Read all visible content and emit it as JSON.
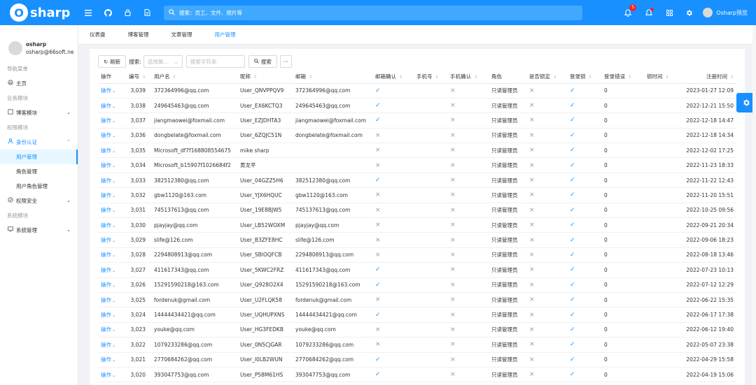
{
  "app": {
    "logo_letter": "O",
    "logo_text": "sharp"
  },
  "topbar": {
    "search_placeholder": "搜索：员工、文件、照片等",
    "notification_count": "5",
    "user_name": "Osharp预览"
  },
  "sidebar": {
    "user_name": "osharp",
    "user_email": "osharp@66soft.ne",
    "groups": {
      "nav": "导航菜单",
      "business": "业务模块",
      "permission": "权限模块",
      "system": "系统模块"
    },
    "items": {
      "home": "主页",
      "blog": "博客模块",
      "identity": "身份认证",
      "user_mgmt": "用户管理",
      "role_mgmt": "角色管理",
      "user_role_mgmt": "用户角色管理",
      "security": "权限安全",
      "sys_mgmt": "系统管理"
    }
  },
  "tabs": [
    "仪表盘",
    "博客管理",
    "文章管理",
    "用户管理"
  ],
  "toolbar": {
    "refresh": "刷新",
    "search_label": "搜索:",
    "select_placeholder": "选择属...",
    "text_placeholder": "搜索字符串",
    "search_btn": "搜索",
    "more": "···"
  },
  "table": {
    "headers": [
      "操作",
      "编号",
      "用户名",
      "昵称",
      "邮箱",
      "邮箱确认",
      "手机号",
      "手机确认",
      "角色",
      "是否锁定",
      "登录锁",
      "登录错误",
      "锁时间",
      "注册时间"
    ],
    "op_label": "操作",
    "rows": [
      {
        "id": "3,039",
        "user": "372364996@qq.com",
        "nick": "User_QNVPPQV9",
        "email": "372364996@qq.com",
        "ec": true,
        "mc": false,
        "role": "只读管理员",
        "locked": false,
        "lock": true,
        "err": "0",
        "time": "2023-01-27 12:09"
      },
      {
        "id": "3,038",
        "user": "249645463@qq.com",
        "nick": "User_EX6KCTQ3",
        "email": "249645463@qq.com",
        "ec": true,
        "mc": false,
        "role": "只读管理员",
        "locked": false,
        "lock": true,
        "err": "0",
        "time": "2022-12-21 15:50"
      },
      {
        "id": "3,037",
        "user": "jiangmaowei@foxmail.com",
        "nick": "User_EZJDHTA3",
        "email": "jiangmaowei@foxmail.com",
        "ec": true,
        "mc": false,
        "role": "只读管理员",
        "locked": false,
        "lock": true,
        "err": "0",
        "time": "2022-12-18 14:47"
      },
      {
        "id": "3,036",
        "user": "dongbelate@foxmail.com",
        "nick": "User_6ZQJC51N",
        "email": "dongbelate@foxmail.com",
        "ec": false,
        "mc": false,
        "role": "只读管理员",
        "locked": false,
        "lock": true,
        "err": "0",
        "time": "2022-12-18 14:34"
      },
      {
        "id": "3,035",
        "user": "Microsoft_df7f16880855467​5",
        "nick": "mike sharp",
        "email": "",
        "ec": false,
        "mc": false,
        "role": "只读管理员",
        "locked": false,
        "lock": true,
        "err": "0",
        "time": "2022-12-02 17:25"
      },
      {
        "id": "3,034",
        "user": "Microsoft_b15907f1026684f2",
        "nick": "黄龙平",
        "email": "",
        "ec": false,
        "mc": false,
        "role": "只读管理员",
        "locked": false,
        "lock": true,
        "err": "0",
        "time": "2022-11-23 18:33"
      },
      {
        "id": "3,033",
        "user": "382512380@qq.com",
        "nick": "User_04GZZ5H6",
        "email": "382512380@qq.com",
        "ec": true,
        "mc": false,
        "role": "只读管理员",
        "locked": false,
        "lock": true,
        "err": "0",
        "time": "2022-11-22 12:43"
      },
      {
        "id": "3,032",
        "user": "gbw1120@163.com",
        "nick": "User_YJX6HQUC",
        "email": "gbw1120@163.com",
        "ec": false,
        "mc": false,
        "role": "只读管理员",
        "locked": false,
        "lock": true,
        "err": "0",
        "time": "2022-11-20 15:51"
      },
      {
        "id": "3,031",
        "user": "745137613@qq.com",
        "nick": "User_19E8BJW5",
        "email": "745137613@qq.com",
        "ec": false,
        "mc": false,
        "role": "只读管理员",
        "locked": false,
        "lock": true,
        "err": "0",
        "time": "2022-10-25 09:56"
      },
      {
        "id": "3,030",
        "user": "pjayjay@qq.com",
        "nick": "User_LB52WOXM",
        "email": "pjayjay@qq.com",
        "ec": false,
        "mc": false,
        "role": "只读管理员",
        "locked": false,
        "lock": true,
        "err": "0",
        "time": "2022-09-21 20:34"
      },
      {
        "id": "3,029",
        "user": "slife@126.com",
        "nick": "User_B3ZFE8HC",
        "email": "slife@126.com",
        "ec": false,
        "mc": false,
        "role": "只读管理员",
        "locked": false,
        "lock": true,
        "err": "0",
        "time": "2022-09-06 18:23"
      },
      {
        "id": "3,028",
        "user": "2294808913@qq.com",
        "nick": "User_SBIOQFCB",
        "email": "2294808913@qq.com",
        "ec": false,
        "mc": false,
        "role": "只读管理员",
        "locked": false,
        "lock": true,
        "err": "0",
        "time": "2022-08-18 13:46"
      },
      {
        "id": "3,027",
        "user": "411617343@qq.com",
        "nick": "User_5KWC2FRZ",
        "email": "411617343@qq.com",
        "ec": true,
        "mc": false,
        "role": "只读管理员",
        "locked": false,
        "lock": true,
        "err": "0",
        "time": "2022-07-23 10:13"
      },
      {
        "id": "3,026",
        "user": "15291590218@163.com",
        "nick": "User_Q928O2X4",
        "email": "15291590218@163.com",
        "ec": true,
        "mc": false,
        "role": "只读管理员",
        "locked": false,
        "lock": true,
        "err": "0",
        "time": "2022-07-12 12:29"
      },
      {
        "id": "3,025",
        "user": "fordenuk@gmail.com",
        "nick": "User_U2FLQK58",
        "email": "fordenuk@gmail.com",
        "ec": false,
        "mc": false,
        "role": "只读管理员",
        "locked": false,
        "lock": true,
        "err": "0",
        "time": "2022-06-22 15:35"
      },
      {
        "id": "3,024",
        "user": "14444434421@qq.com",
        "nick": "User_UQHUPXNS",
        "email": "14444434421@qq.com",
        "ec": true,
        "mc": false,
        "role": "只读管理员",
        "locked": false,
        "lock": true,
        "err": "0",
        "time": "2022-06-17 17:38"
      },
      {
        "id": "3,023",
        "user": "youke@qq.com",
        "nick": "User_HG3FEDKB",
        "email": "youke@qq.com",
        "ec": false,
        "mc": false,
        "role": "只读管理员",
        "locked": false,
        "lock": true,
        "err": "0",
        "time": "2022-06-12 19:40"
      },
      {
        "id": "3,022",
        "user": "1079233286@qq.com",
        "nick": "User_0N5CJGAR",
        "email": "1079233286@qq.com",
        "ec": false,
        "mc": false,
        "role": "只读管理员",
        "locked": false,
        "lock": true,
        "err": "0",
        "time": "2022-05-07 23:38"
      },
      {
        "id": "3,021",
        "user": "2770684262@qq.com",
        "nick": "User_I0LB2WUN",
        "email": "2770684262@qq.com",
        "ec": true,
        "mc": false,
        "role": "只读管理员",
        "locked": false,
        "lock": true,
        "err": "0",
        "time": "2022-04-29 15:58"
      },
      {
        "id": "3,020",
        "user": "393047753@qq.com",
        "nick": "User_P58M61HS",
        "email": "393047753@qq.com",
        "ec": true,
        "mc": false,
        "role": "只读管理员",
        "locked": false,
        "lock": true,
        "err": "0",
        "time": "2022-04-19 15:06"
      }
    ]
  }
}
